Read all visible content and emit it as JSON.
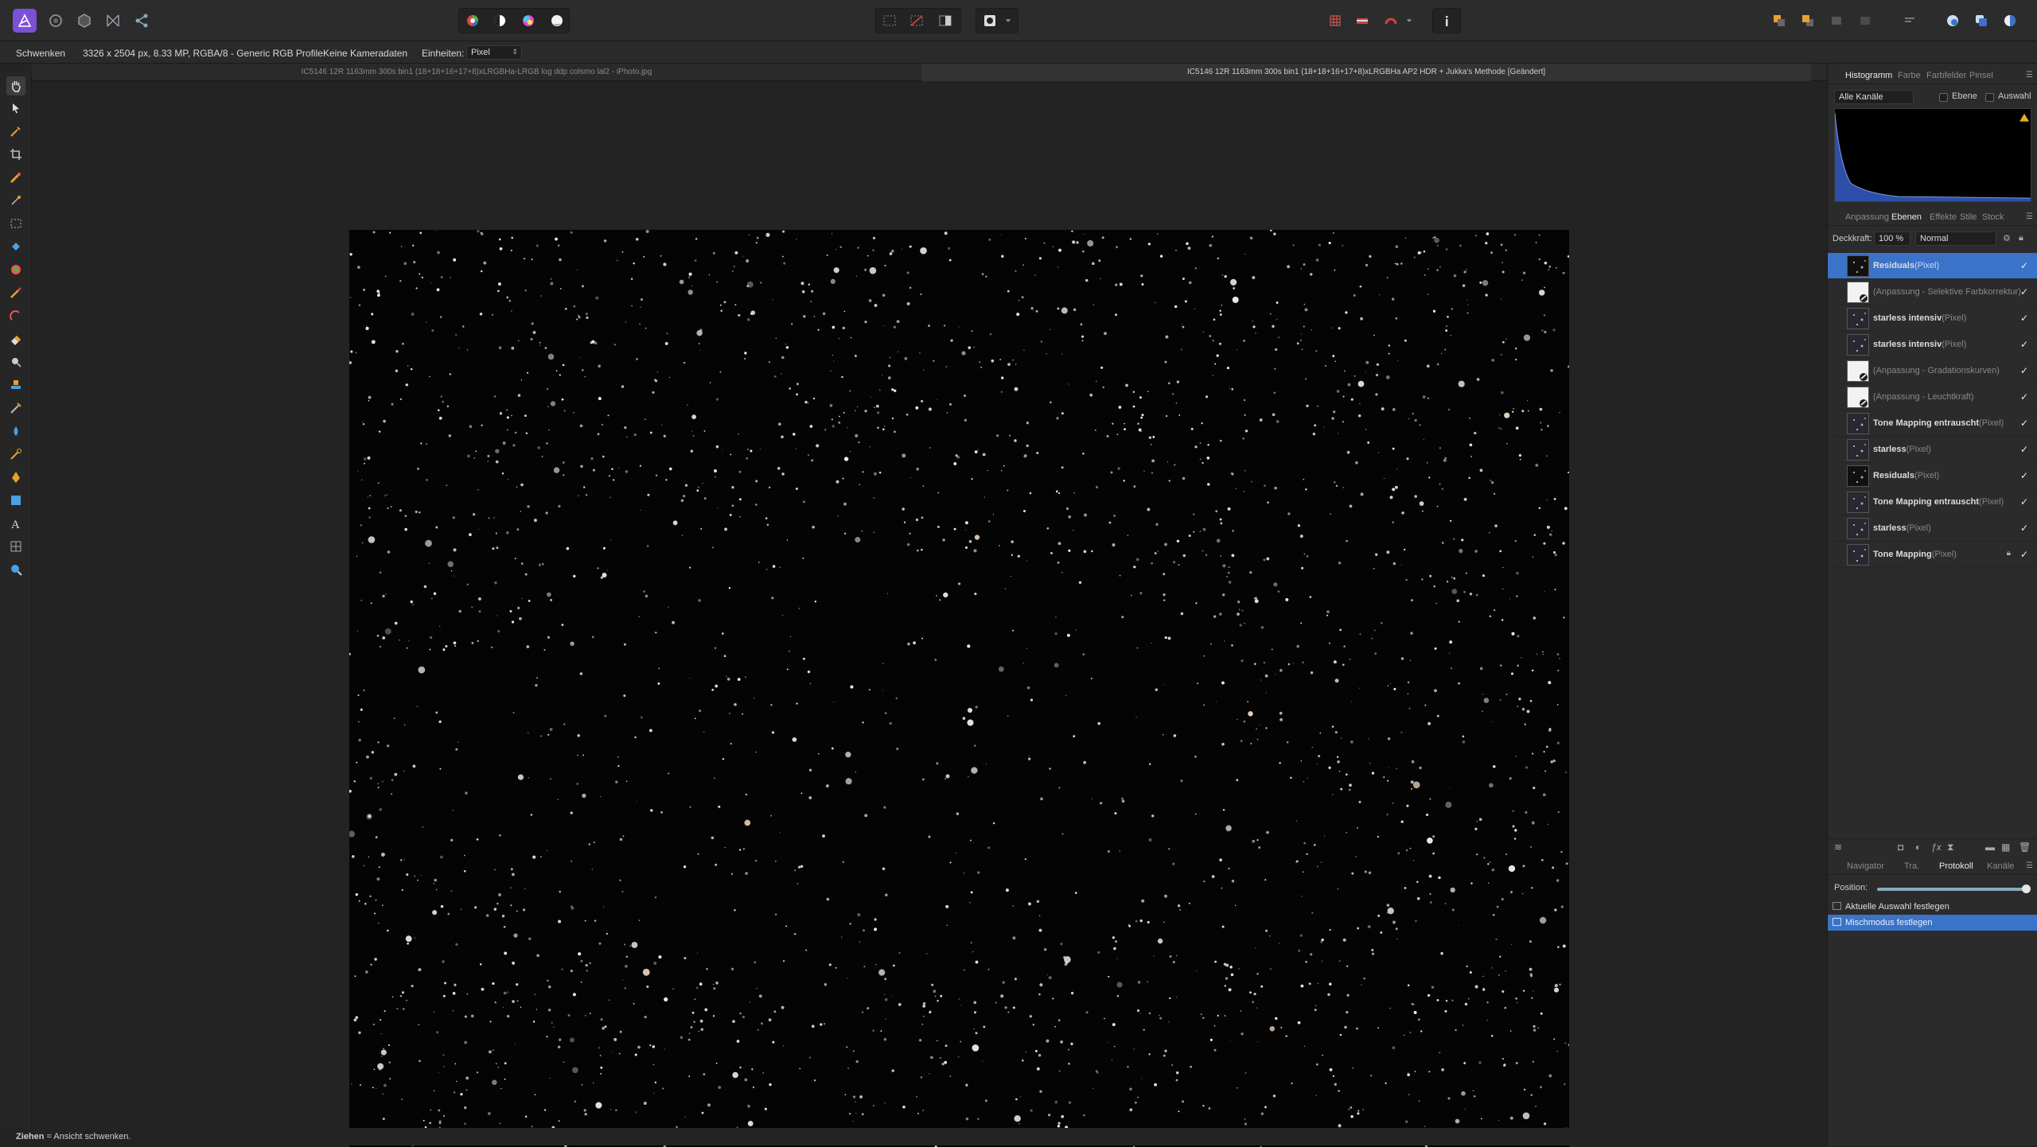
{
  "toolbar": {
    "personas": [
      "affinity-photo-icon",
      "develop-persona-icon",
      "liquify-persona-icon",
      "tone-mapping-persona-icon",
      "export-persona-icon"
    ],
    "icons": [
      "color-wheel-icon",
      "contrast-icon",
      "saturation-icon",
      "white-balance-icon",
      "marquee-icon",
      "deselect-icon",
      "invert-selection-icon",
      "quick-mask-icon",
      "grid-icon",
      "flag-icon",
      "snapping-icon",
      "info-icon",
      "arrange-back-icon",
      "arrange-front-icon",
      "arrange-icon",
      "arrange-icon-2",
      "align-icon",
      "assistant-icon",
      "export-icon",
      "studio-icon"
    ]
  },
  "context": {
    "tool": "Schwenken",
    "info": "3326 x 2504 px, 8.33 MP, RGBA/8 - Generic RGB Profile",
    "camera": "Keine Kameradaten",
    "units_label": "Einheiten:",
    "units_value": "Pixel"
  },
  "documents": {
    "tab1": "IC5146 12R 1163mm 300s bin1 (18+18+16+17+8)xLRGBHa-LRGB log ddp colsmo lal2 - iPhoto.jpg",
    "tab2": "IC5146 12R 1163mm 300s bin1 (18+18+16+17+8)xLRGBHa AP2 HDR + Jukka's Methode [Geändert]"
  },
  "panels": {
    "histogram_tabs": [
      "Histogramm",
      "Farbe",
      "Farbfelder",
      "Pinsel"
    ],
    "channels": "Alle Kanäle",
    "ebene_label": "Ebene",
    "auswahl_label": "Auswahl",
    "layer_tabs": [
      "Anpassung",
      "Ebenen",
      "Effekte",
      "Stile",
      "Stock"
    ],
    "opacity_label": "Deckkraft:",
    "opacity_value": "100 %",
    "blend_mode": "Normal",
    "layers": [
      {
        "name": "Residuals",
        "kind": "(Pixel)",
        "type": "pixel",
        "selected": true
      },
      {
        "name": "(Anpassung - Selektive Farbkorrektur)",
        "kind": "",
        "type": "adj"
      },
      {
        "name": "starless intensiv",
        "kind": "(Pixel)",
        "type": "pixel"
      },
      {
        "name": "starless intensiv",
        "kind": "(Pixel)",
        "type": "pixel"
      },
      {
        "name": "(Anpassung - Gradationskurven)",
        "kind": "",
        "type": "adj"
      },
      {
        "name": "(Anpassung - Leuchtkraft)",
        "kind": "",
        "type": "adj"
      },
      {
        "name": "Tone Mapping entrauscht",
        "kind": "(Pixel)",
        "type": "pixel"
      },
      {
        "name": "starless",
        "kind": "(Pixel)",
        "type": "pixel"
      },
      {
        "name": "Residuals",
        "kind": "(Pixel)",
        "type": "pixel"
      },
      {
        "name": "Tone Mapping entrauscht",
        "kind": "(Pixel)",
        "type": "pixel"
      },
      {
        "name": "starless",
        "kind": "(Pixel)",
        "type": "pixel"
      },
      {
        "name": "Tone Mapping",
        "kind": "(Pixel)",
        "type": "pixel",
        "locked": true
      }
    ],
    "bottom_tabs": [
      "Navigator",
      "Tra.",
      "Protokoll",
      "Kanäle"
    ],
    "position_label": "Position:",
    "history": [
      "Aktuelle Auswahl festlegen",
      "Mischmodus festlegen"
    ]
  },
  "status": {
    "bold": "Ziehen",
    "text": " = Ansicht schwenken."
  },
  "colors": {
    "accent": "#3a73c8",
    "app_icon": "#7b4fd6"
  }
}
